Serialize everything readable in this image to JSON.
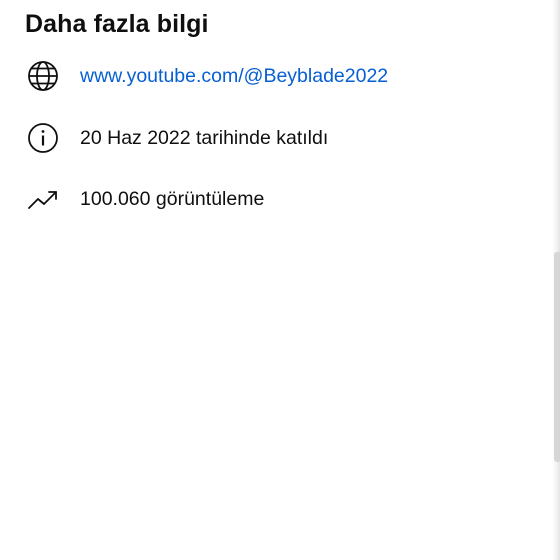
{
  "section": {
    "title": "Daha fazla bilgi"
  },
  "rows": [
    {
      "icon": "globe-icon",
      "text": "www.youtube.com/@Beyblade2022"
    },
    {
      "icon": "info-icon",
      "text": "20 Haz 2022 tarihinde katıldı"
    },
    {
      "icon": "trending-up-icon",
      "text": "100.060 görüntüleme"
    }
  ],
  "colors": {
    "link": "#065fd4",
    "text": "#0f0f0f",
    "background": "#ffffff"
  }
}
